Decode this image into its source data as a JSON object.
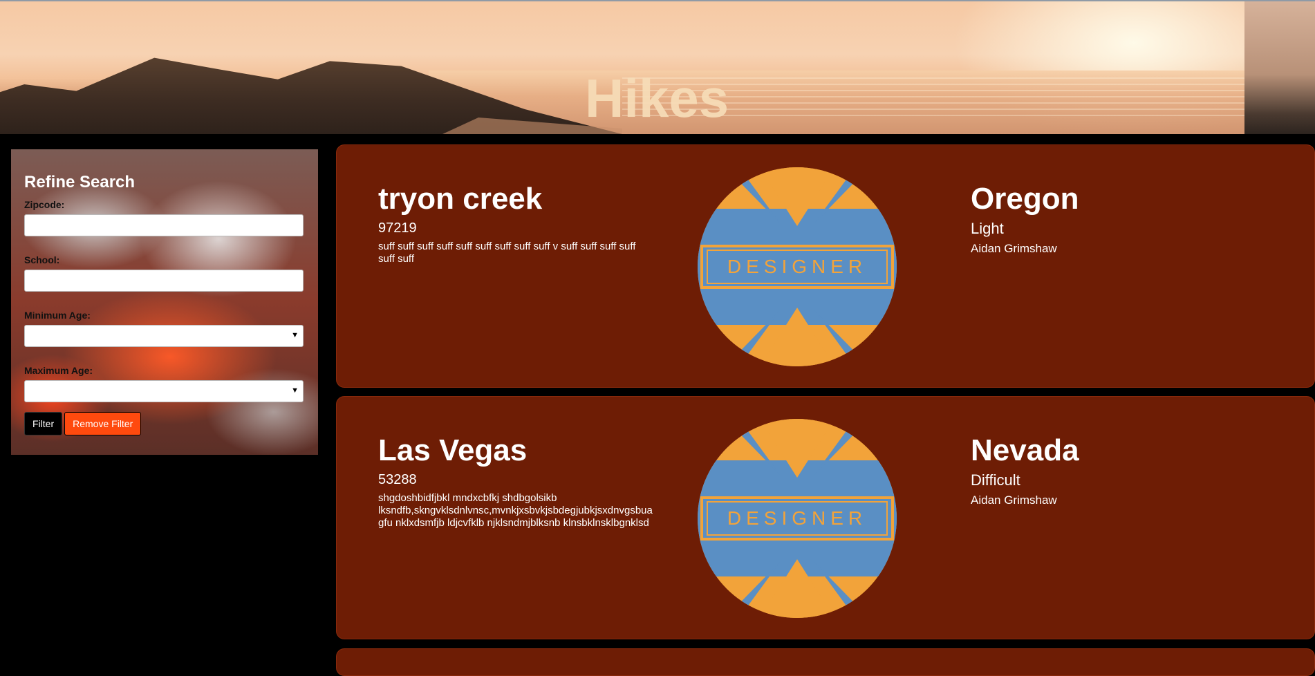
{
  "header": {
    "title": "Hikes"
  },
  "sidebar": {
    "title": "Refine Search",
    "zipcode_label": "Zipcode:",
    "school_label": "School:",
    "min_age_label": "Minimum Age:",
    "max_age_label": "Maximum Age:",
    "filter_button": "Filter",
    "remove_filter_button": "Remove Filter"
  },
  "hikes": [
    {
      "name": "tryon creek",
      "zip": "97219",
      "description": "suff suff suff suff suff suff suff suff suff v suff suff suff suff suff suff",
      "badge_text": "DESIGNER",
      "state": "Oregon",
      "difficulty": "Light",
      "author": "Aidan Grimshaw"
    },
    {
      "name": "Las Vegas",
      "zip": "53288",
      "description": "shgdoshbidfjbkl mndxcbfkj shdbgolsikb lksndfb,skngvklsdnlvnsc,mvnkjxsbvkjsbdegjubkjsxdnvgsbuagfu nklxdsmfjb ldjcvfklb njklsndmjblksnb klnsbklnsklbgnklsd",
      "badge_text": "DESIGNER",
      "state": "Nevada",
      "difficulty": "Difficult",
      "author": "Aidan Grimshaw"
    }
  ],
  "colors": {
    "card_bg": "#6e1d05",
    "remove_filter": "#ff4a0e",
    "badge_blue": "#5a8fc4",
    "badge_orange": "#f2a33a"
  }
}
